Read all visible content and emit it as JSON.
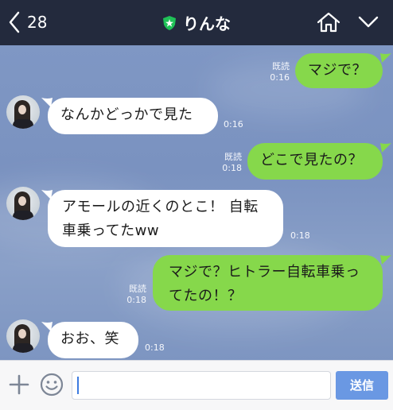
{
  "header": {
    "unread_count": "28",
    "title": "りんな",
    "badge_color": "#1fc157"
  },
  "messages": [
    {
      "side": "out",
      "text": "マジで？",
      "read": "既読",
      "time": "0:16"
    },
    {
      "side": "in",
      "text": "なんかどっかで見た",
      "time": "0:16"
    },
    {
      "side": "out",
      "text": "どこで見たの？",
      "read": "既読",
      "time": "0:18"
    },
    {
      "side": "in",
      "lines": [
        "アモールの近くのとこ！ 自転",
        "車乗ってたww"
      ],
      "time": "0:18"
    },
    {
      "side": "out",
      "lines": [
        "マジで？ヒトラー自転車乗っ",
        "てたの！？"
      ],
      "read": "既読",
      "time": "0:18"
    },
    {
      "side": "in",
      "text": "おお、笑",
      "time": "0:18"
    }
  ],
  "composer": {
    "input_value": "",
    "send_label": "送信"
  },
  "colors": {
    "header_bg": "#232a3d",
    "chat_bg": "#7c94c0",
    "outgoing_bubble": "#86d84b",
    "incoming_bubble": "#ffffff",
    "send_button": "#6a98e3"
  }
}
